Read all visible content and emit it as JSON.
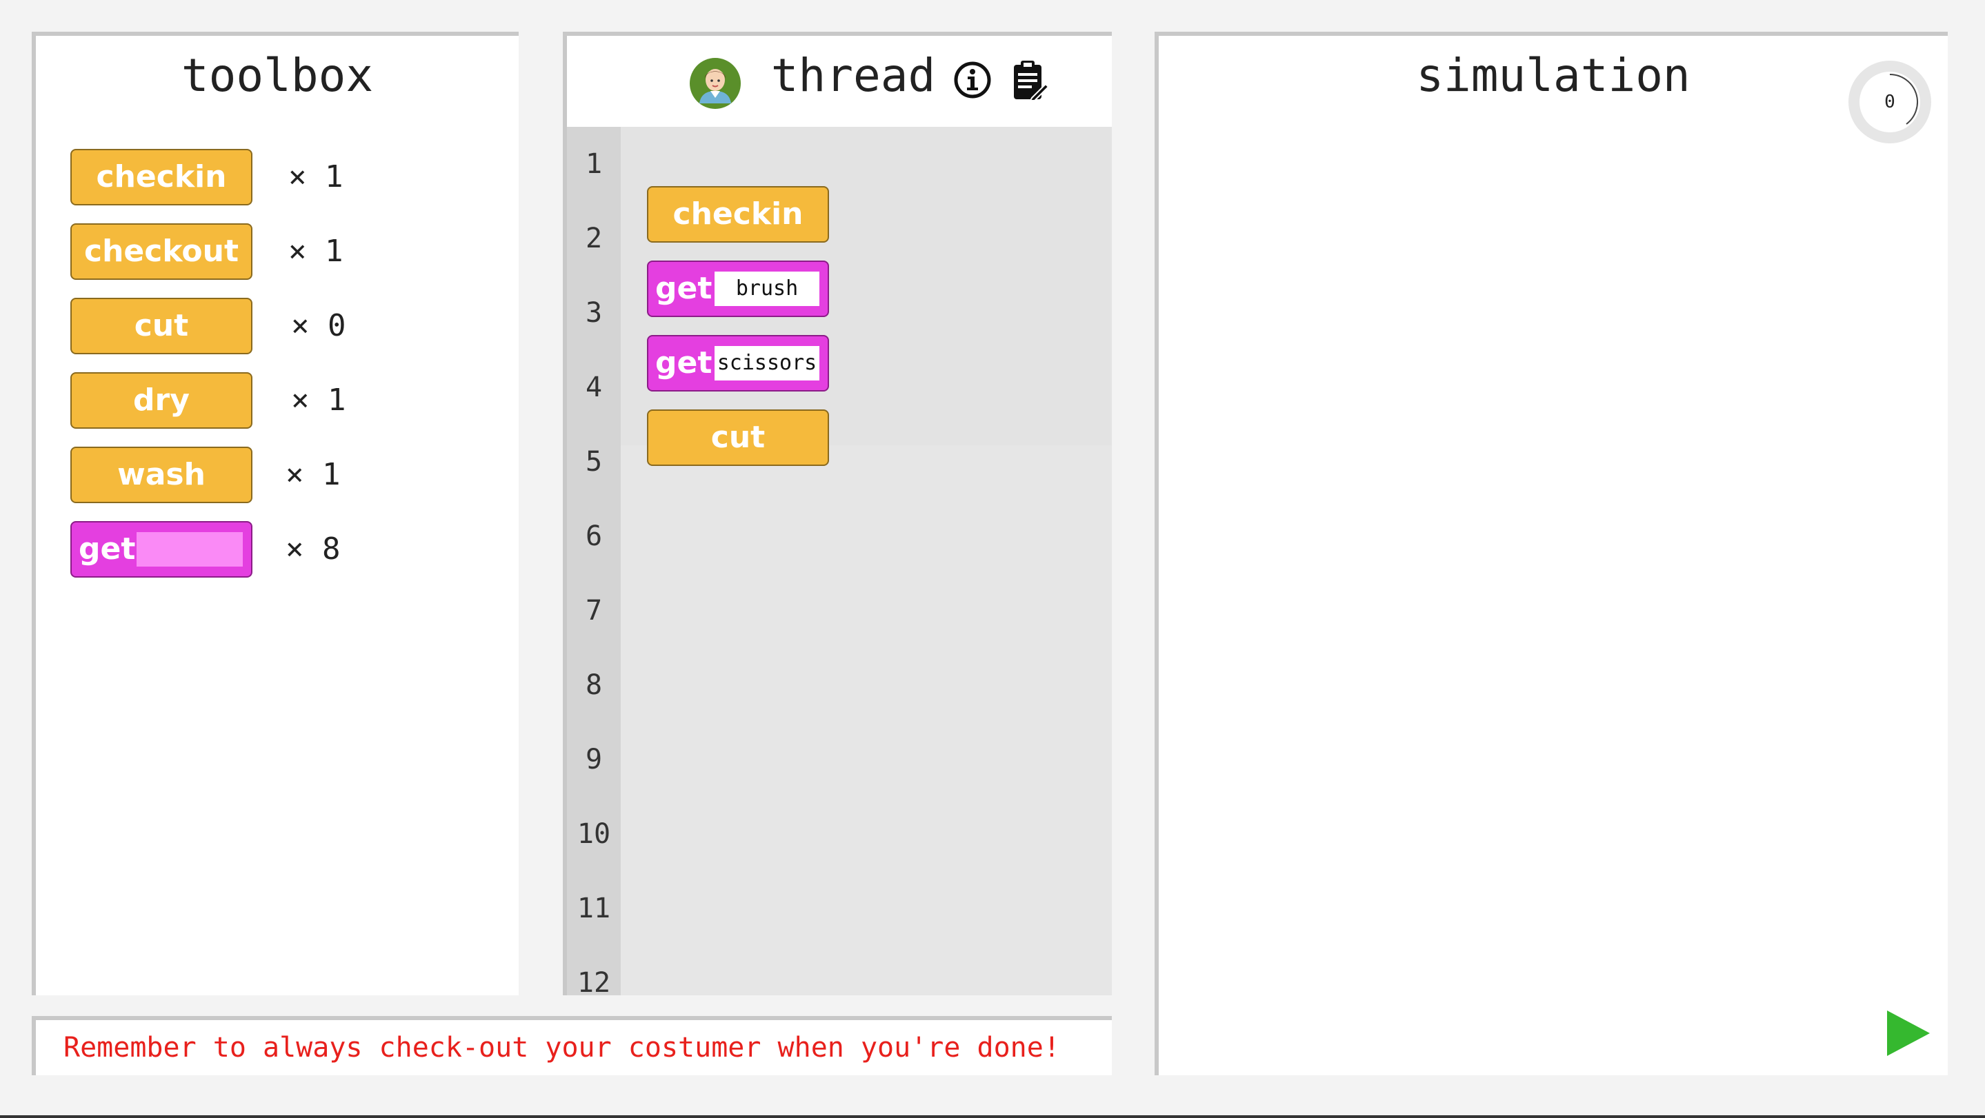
{
  "toolbox": {
    "title": "toolbox",
    "items": [
      {
        "label": "checkin",
        "count": "× 1",
        "color": "#f5ba3c"
      },
      {
        "label": "checkout",
        "count": "× 1",
        "color": "#f5ba3c"
      },
      {
        "label": "cut",
        "count": "× 0",
        "color": "#f5ba3c"
      },
      {
        "label": "dry",
        "count": "× 1",
        "color": "#f5ba3c"
      },
      {
        "label": "wash",
        "count": "× 1",
        "color": "#f5ba3c"
      },
      {
        "label": "get",
        "count": "× 8",
        "color": "#e43fe0"
      }
    ]
  },
  "thread": {
    "title": "thread",
    "avatar_icon": "user-avatar-icon",
    "info_icon": "info-icon",
    "clipboard_icon": "clipboard-icon",
    "line_numbers": [
      "1",
      "2",
      "3",
      "4",
      "5",
      "6",
      "7",
      "8",
      "9",
      "10",
      "11",
      "12"
    ],
    "blocks": [
      {
        "line": 1,
        "label": "checkin",
        "type": "action"
      },
      {
        "line": 2,
        "label": "get",
        "arg": "brush",
        "type": "get"
      },
      {
        "line": 3,
        "label": "get",
        "arg": "scissors",
        "type": "get"
      },
      {
        "line": 4,
        "label": "cut",
        "type": "action"
      }
    ]
  },
  "simulation": {
    "title": "simulation",
    "counter": "0",
    "play_icon": "play-icon",
    "play_color": "#35b82f"
  },
  "hint": {
    "text": "Remember to always check-out your costumer when you're done!",
    "color": "#e8201c"
  }
}
